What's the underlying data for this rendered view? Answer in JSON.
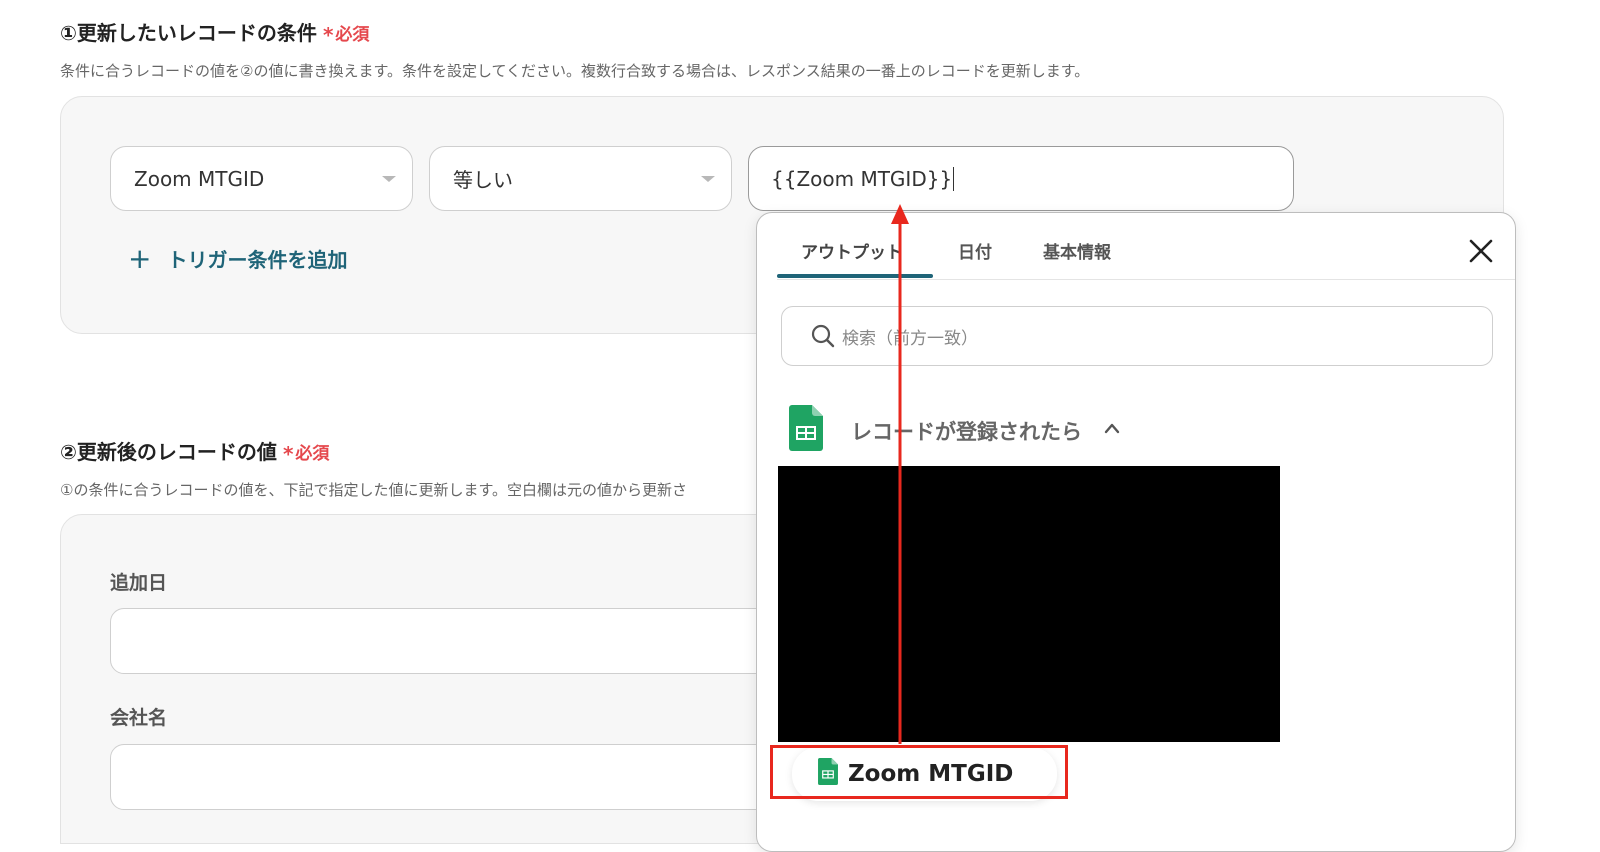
{
  "section1": {
    "title": "①更新したいレコードの条件",
    "required": "必須",
    "description": "条件に合うレコードの値を②の値に書き換えます。条件を設定してください。複数行合致する場合は、レスポンス結果の一番上のレコードを更新します。",
    "condition": {
      "field_value": "Zoom MTGID",
      "operator_value": "等しい",
      "value_input": "{{Zoom MTGID}}"
    },
    "add_condition_label": "トリガー条件を追加"
  },
  "section2": {
    "title": "②更新後のレコードの値",
    "required": "必須",
    "description": "①の条件に合うレコードの値を、下記で指定した値に更新します。空白欄は元の値から更新さ",
    "fields": [
      {
        "label": "追加日",
        "value": ""
      },
      {
        "label": "会社名",
        "value": ""
      }
    ]
  },
  "popup": {
    "tabs": [
      "アウトプット",
      "日付",
      "基本情報"
    ],
    "active_tab": "アウトプット",
    "search_placeholder": "検索（前方一致）",
    "group_label": "レコードが登録されたら",
    "selected_item": "Zoom MTGID"
  },
  "colors": {
    "accent": "#1f6478",
    "required": "#e5484d",
    "highlight": "#e8281e",
    "sheets_green": "#1fa463"
  }
}
